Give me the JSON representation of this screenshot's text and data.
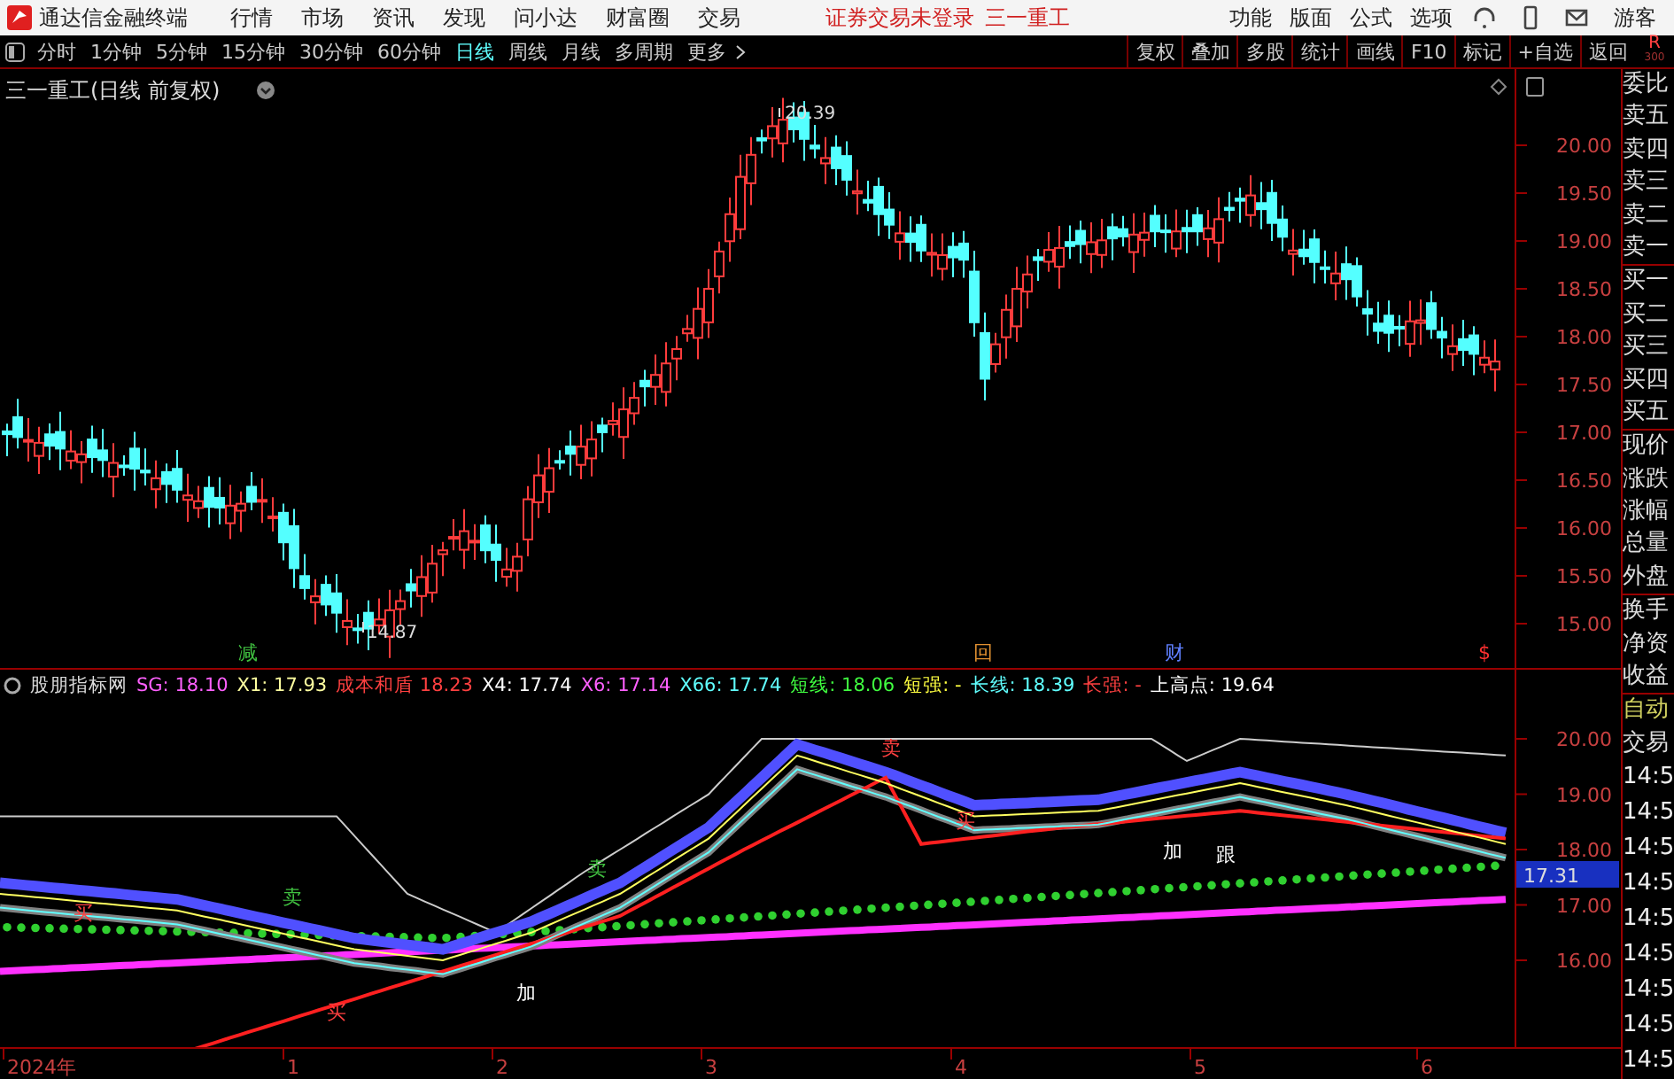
{
  "app_title": "通达信金融终端",
  "menu": [
    "行情",
    "市场",
    "资讯",
    "发现",
    "问小达",
    "财富圈",
    "交易"
  ],
  "login_status": "证券交易未登录",
  "stock_name": "三一重工",
  "right_menu": [
    "功能",
    "版面",
    "公式",
    "选项"
  ],
  "guest": "游客",
  "periods": [
    {
      "label": "分时",
      "selected": false
    },
    {
      "label": "1分钟",
      "selected": false
    },
    {
      "label": "5分钟",
      "selected": false
    },
    {
      "label": "15分钟",
      "selected": false
    },
    {
      "label": "30分钟",
      "selected": false
    },
    {
      "label": "60分钟",
      "selected": false
    },
    {
      "label": "日线",
      "selected": true
    },
    {
      "label": "周线",
      "selected": false
    },
    {
      "label": "月线",
      "selected": false
    },
    {
      "label": "多周期",
      "selected": false
    },
    {
      "label": "更多",
      "selected": false
    }
  ],
  "tools": [
    "复权",
    "叠加",
    "多股",
    "统计",
    "画线",
    "F10",
    "标记",
    "+自选",
    "返回"
  ],
  "corner": {
    "letter": "R",
    "sub": "300"
  },
  "chart": {
    "title": "三一重工(日线 前复权)",
    "high_label": "20.39",
    "low_label": "14.87",
    "price_axis": [
      "20.00",
      "19.50",
      "19.00",
      "18.50",
      "18.00",
      "17.50",
      "17.00",
      "16.50",
      "16.00",
      "15.50",
      "15.00"
    ],
    "markers": [
      {
        "text": "减",
        "color": "#40c040"
      },
      {
        "text": "回",
        "color": "#e09030"
      },
      {
        "text": "财",
        "color": "#6080ff"
      },
      {
        "text": "$",
        "color": "#ff3030"
      }
    ]
  },
  "indicator": {
    "name": "股朋指标网",
    "values": [
      {
        "label": "SG:",
        "value": "18.10",
        "color": "#ff60ff"
      },
      {
        "label": "X1:",
        "value": "17.93",
        "color": "#ffffa0"
      },
      {
        "label": "成本和盾",
        "value": "18.23",
        "color": "#ff4040"
      },
      {
        "label": "X4:",
        "value": "17.74",
        "color": "#ffffff"
      },
      {
        "label": "X6:",
        "value": "17.14",
        "color": "#ff60ff"
      },
      {
        "label": "X66:",
        "value": "17.74",
        "color": "#60ffff"
      },
      {
        "label": "短线:",
        "value": "18.06",
        "color": "#40ff40"
      },
      {
        "label": "短强:",
        "value": "-",
        "color": "#ffff40"
      },
      {
        "label": "长线:",
        "value": "18.39",
        "color": "#60ffff"
      },
      {
        "label": "长强:",
        "value": "-",
        "color": "#ff4040"
      },
      {
        "label": "上高点:",
        "value": "19.64",
        "color": "#ffffff"
      }
    ],
    "axis": [
      "20.00",
      "19.00",
      "18.00",
      "17.00",
      "16.00"
    ],
    "current": "17.31",
    "signals": [
      {
        "text": "买",
        "color": "#ff4040"
      },
      {
        "text": "卖",
        "color": "#40c040"
      },
      {
        "text": "买",
        "color": "#ff4040"
      },
      {
        "text": "加",
        "color": "#ffffff"
      },
      {
        "text": "卖",
        "color": "#40c040"
      },
      {
        "text": "卖",
        "color": "#ff4040"
      },
      {
        "text": "买",
        "color": "#ff4040"
      },
      {
        "text": "加",
        "color": "#ffffff"
      },
      {
        "text": "跟",
        "color": "#ffffff"
      }
    ]
  },
  "time_axis": [
    "2024年",
    "1",
    "2",
    "3",
    "4",
    "5",
    "6"
  ],
  "quote_labels": [
    "委比",
    "卖五",
    "卖四",
    "卖三",
    "卖二",
    "卖一",
    "买一",
    "买二",
    "买三",
    "买四",
    "买五",
    "现价",
    "涨跌",
    "涨幅",
    "总量",
    "外盘",
    "换手",
    "净资",
    "收益"
  ],
  "trade_labels": [
    "自动",
    "交易"
  ],
  "tick_times": [
    "14:5",
    "14:5",
    "14:5",
    "14:5",
    "14:5",
    "14:5",
    "14:5",
    "14:5",
    "14:5"
  ]
}
